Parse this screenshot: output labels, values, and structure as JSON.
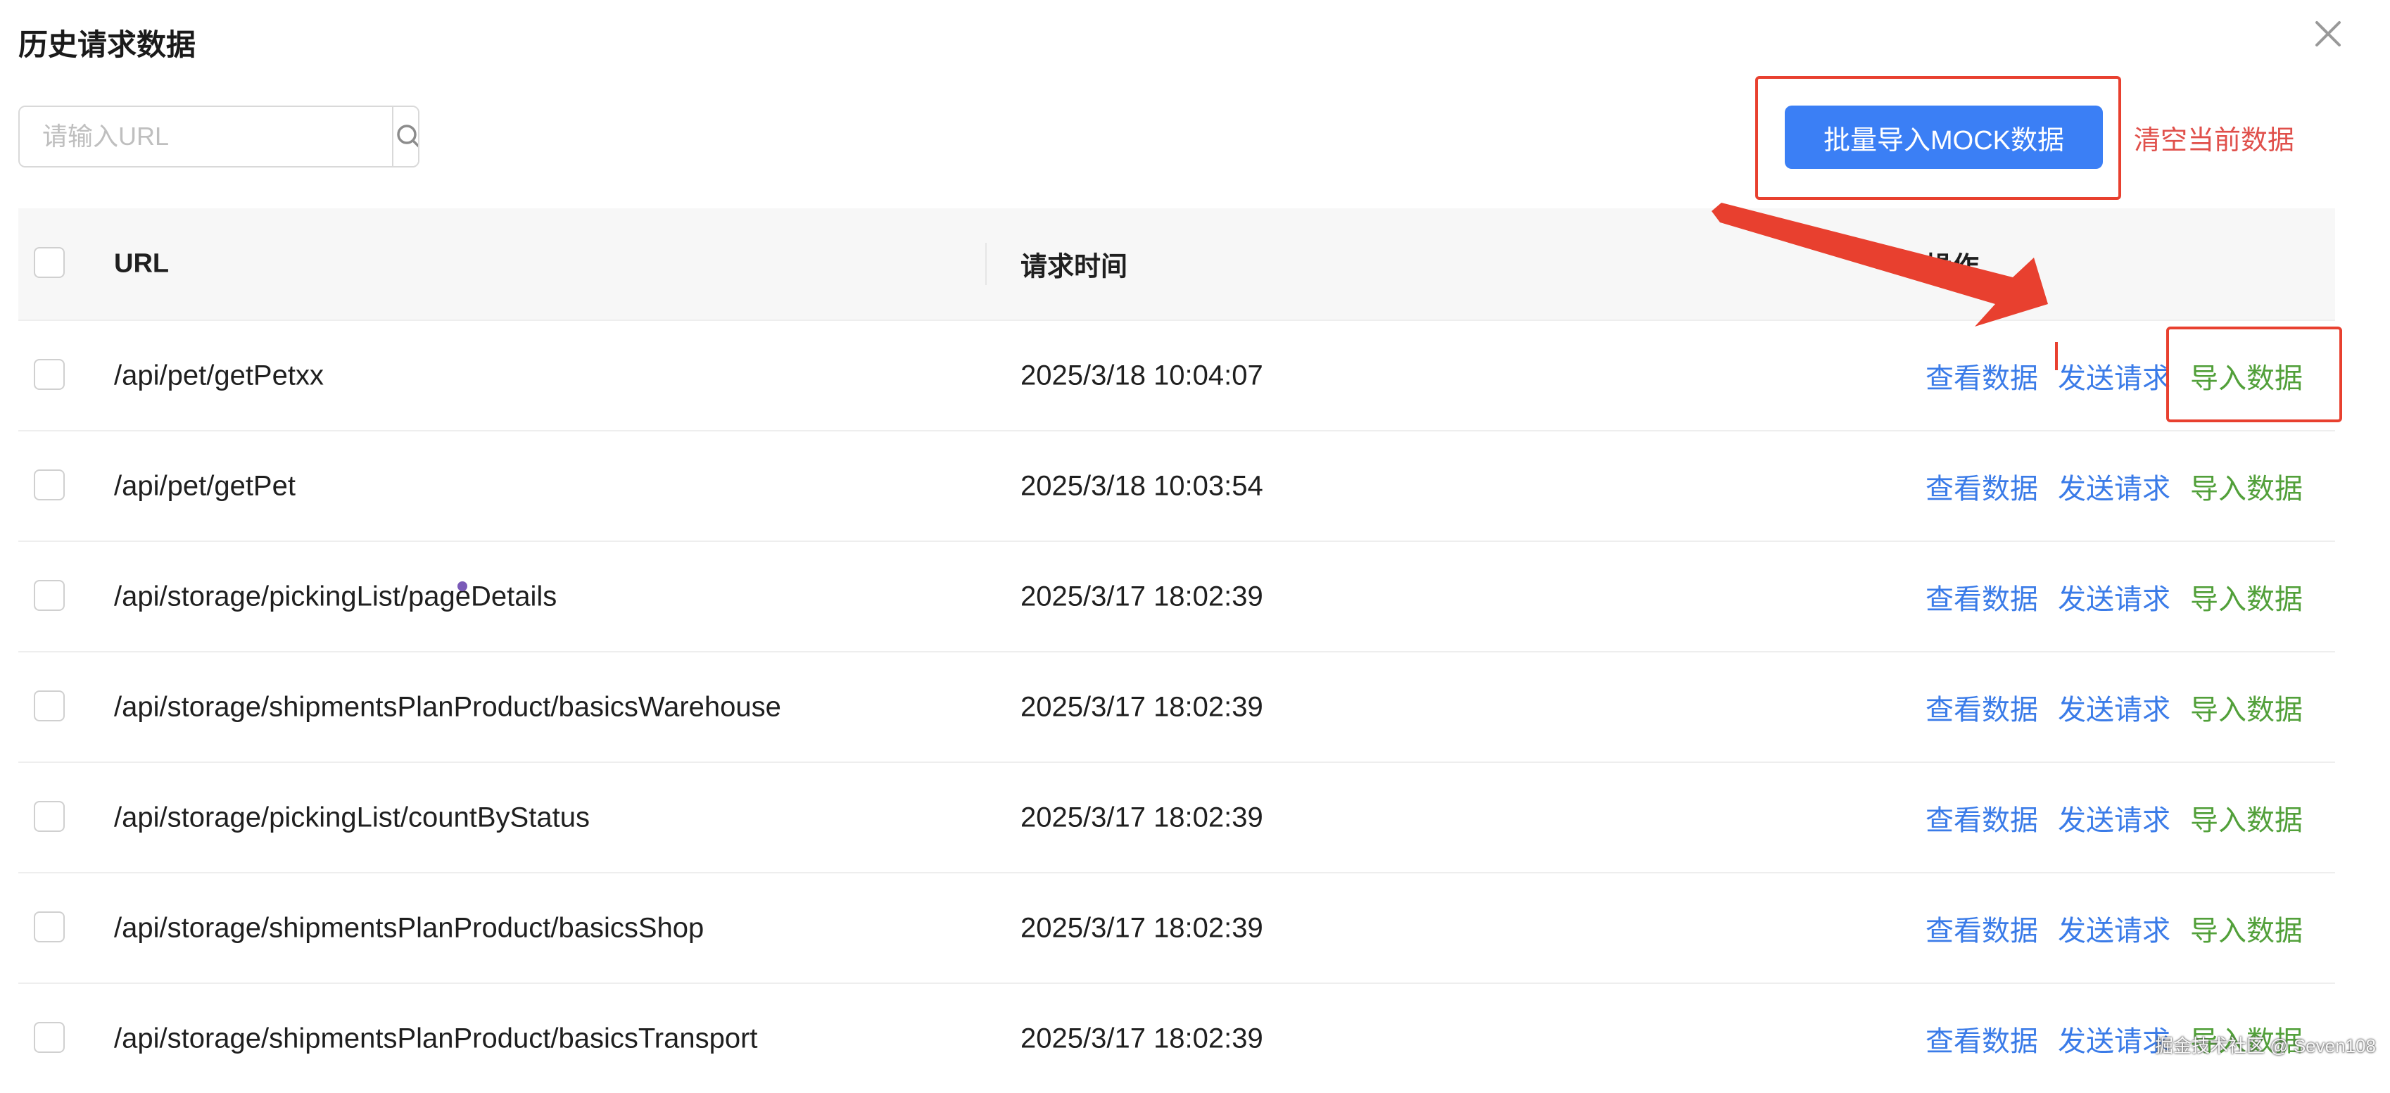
{
  "dialog": {
    "title": "历史请求数据"
  },
  "search": {
    "placeholder": "请输入URL",
    "value": ""
  },
  "toolbar": {
    "batch_import_label": "批量导入MOCK数据",
    "clear_label": "清空当前数据"
  },
  "table": {
    "headers": {
      "url": "URL",
      "time": "请求时间",
      "actions": "操作"
    },
    "rows": [
      {
        "url": "/api/pet/getPetxx",
        "time": "2025/3/18 10:04:07"
      },
      {
        "url": "/api/pet/getPet",
        "time": "2025/3/18 10:03:54"
      },
      {
        "url": "/api/storage/pickingList/pageDetails",
        "time": "2025/3/17 18:02:39"
      },
      {
        "url": "/api/storage/shipmentsPlanProduct/basicsWarehouse",
        "time": "2025/3/17 18:02:39"
      },
      {
        "url": "/api/storage/pickingList/countByStatus",
        "time": "2025/3/17 18:02:39"
      },
      {
        "url": "/api/storage/shipmentsPlanProduct/basicsShop",
        "time": "2025/3/17 18:02:39"
      },
      {
        "url": "/api/storage/shipmentsPlanProduct/basicsTransport",
        "time": "2025/3/17 18:02:39"
      }
    ],
    "actions": {
      "view": "查看数据",
      "send": "发送请求",
      "import": "导入数据"
    }
  },
  "watermark": "掘金技术社区 @ Seven108",
  "colors": {
    "primary": "#3b7ff5",
    "link": "#3a7be8",
    "import": "#52a03a",
    "danger": "#e0504b",
    "annotation": "#e8402f"
  },
  "icons": {
    "close": "close-icon",
    "search": "search-icon"
  }
}
